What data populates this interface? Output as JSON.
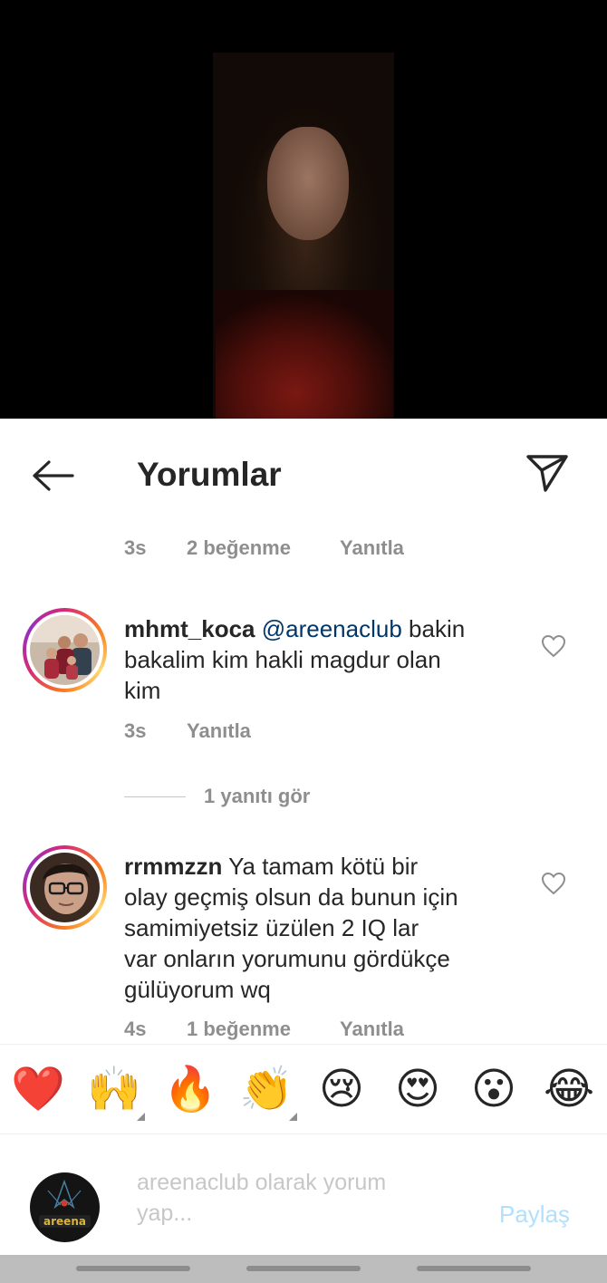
{
  "header": {
    "title": "Yorumlar"
  },
  "top_meta": {
    "time": "3s",
    "likes": "2 beğenme",
    "reply": "Yanıtla"
  },
  "comments": [
    {
      "username": "mhmt_koca",
      "mention": "@areenaclub",
      "text_line1": " bakin",
      "text_line2": "bakalim kim hakli magdur olan",
      "text_line3": "kim",
      "time": "3s",
      "reply": "Yanıtla"
    },
    {
      "username": "rrmmzzn",
      "text_line1": " Ya tamam kötü bir",
      "text_line2": "olay geçmiş olsun da bunun için",
      "text_line3": "samimiyetsiz üzülen 2 IQ lar",
      "text_line4": "var onların yorumunu gördükçe",
      "text_line5": "gülüyorum wq",
      "time": "4s",
      "likes": "1 beğenme",
      "reply": "Yanıtla"
    }
  ],
  "view_replies": "1 yanıtı gör",
  "emoji_bar": [
    "❤️",
    "🙌",
    "🔥",
    "👏",
    "😢",
    "😍",
    "😮",
    "😂"
  ],
  "composer": {
    "placeholder_line1": "areenaclub olarak yorum",
    "placeholder_line2": "yap...",
    "share": "Paylaş",
    "avatar_text": "areena"
  },
  "colors": {
    "accent_link": "#00376b",
    "muted": "#8e8e8e",
    "share_disabled": "#b2dffc"
  }
}
